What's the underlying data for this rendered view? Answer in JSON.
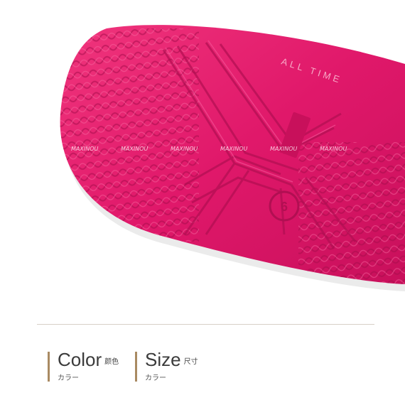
{
  "photo": {
    "watermark": "MAXINOU",
    "sole_text": "ALL TIME",
    "colors": {
      "sole": "#e0186a",
      "sole_dark": "#b10f52",
      "sole_light": "#f24d8d"
    }
  },
  "specs": {
    "color": {
      "label": "Color",
      "label_jp": "颜色",
      "sub": "カラー"
    },
    "size": {
      "label": "Size",
      "label_jp": "尺寸",
      "sub": "カラー"
    }
  },
  "colors": {
    "divider": "#d7d0c7",
    "accent_bar": "#a98a62"
  }
}
